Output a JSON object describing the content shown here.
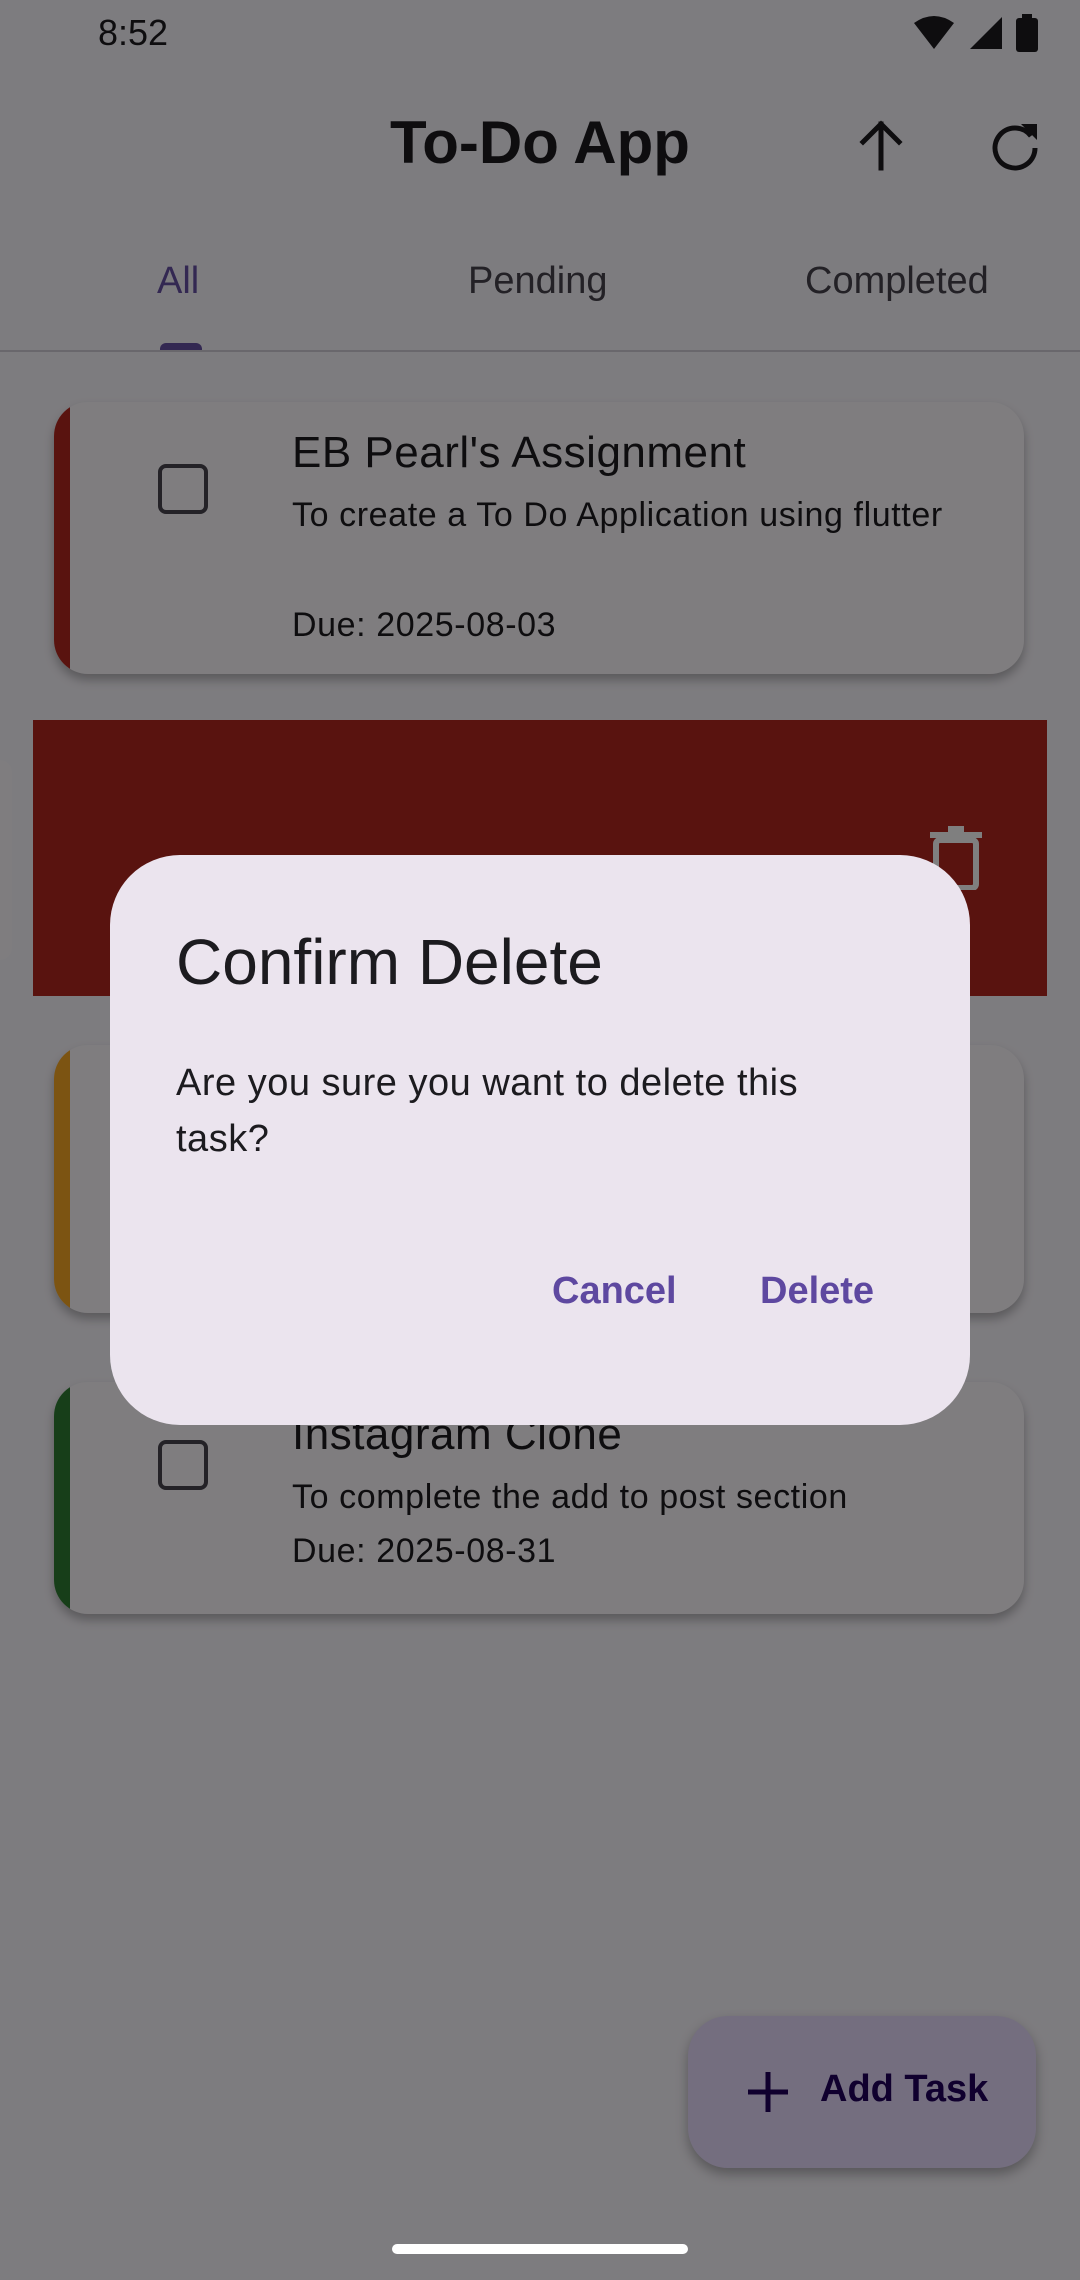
{
  "status_bar": {
    "time": "8:52"
  },
  "app_bar": {
    "title": "To-Do App",
    "actions": [
      "arrow-up-icon",
      "refresh-icon"
    ]
  },
  "tabs": [
    {
      "label": "All",
      "active": true
    },
    {
      "label": "Pending",
      "active": false
    },
    {
      "label": "Completed",
      "active": false
    }
  ],
  "tasks": [
    {
      "title": "EB Pearl's Assignment",
      "description": "To create a To Do Application using flutter",
      "due": "Due: 2025-08-03",
      "priority_color": "#b3261e",
      "completed": false
    },
    {
      "title": "Instagram Clone",
      "description": "To complete the add to post section",
      "due": "Due: 2025-08-31",
      "priority_color": "#2e7d32",
      "completed": false
    }
  ],
  "swipe_delete": {
    "background_color": "#b3261e",
    "icon": "trash-icon"
  },
  "fab": {
    "label": "Add Task",
    "icon": "plus-icon"
  },
  "dialog": {
    "title": "Confirm Delete",
    "message": "Are you sure you want to delete this task?",
    "cancel_label": "Cancel",
    "delete_label": "Delete"
  }
}
